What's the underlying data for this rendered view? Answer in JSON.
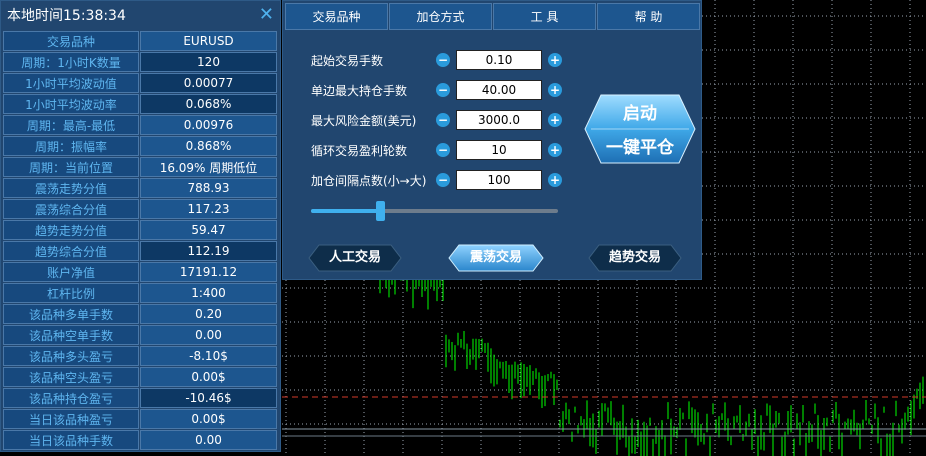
{
  "info": {
    "title": "本地时间15:38:34",
    "rows": [
      {
        "label": "交易品种",
        "value": "EURUSD"
      },
      {
        "label": "周期：1小时K数量",
        "value": "120"
      },
      {
        "label": "1小时平均波动值",
        "value": "0.00077"
      },
      {
        "label": "1小时平均波动率",
        "value": "0.068%"
      },
      {
        "label": "周期：最高-最低",
        "value": "0.00976"
      },
      {
        "label": "周期：振幅率",
        "value": "0.868%"
      },
      {
        "label": "周期：当前位置",
        "value": "16.09% 周期低位"
      },
      {
        "label": "震荡走势分值",
        "value": "788.93"
      },
      {
        "label": "震荡综合分值",
        "value": "117.23"
      },
      {
        "label": "趋势走势分值",
        "value": "59.47"
      },
      {
        "label": "趋势综合分值",
        "value": "112.19"
      },
      {
        "label": "账户净值",
        "value": "17191.12"
      },
      {
        "label": "杠杆比例",
        "value": "1:400"
      },
      {
        "label": "该品种多单手数",
        "value": "0.20"
      },
      {
        "label": "该品种空单手数",
        "value": "0.00"
      },
      {
        "label": "该品种多头盈亏",
        "value": "-8.10$"
      },
      {
        "label": "该品种空头盈亏",
        "value": "0.00$"
      },
      {
        "label": "该品种持仓盈亏",
        "value": "-10.46$"
      },
      {
        "label": "当日该品种盈亏",
        "value": "0.00$"
      },
      {
        "label": "当日该品种手数",
        "value": "0.00"
      }
    ],
    "close_icon": "close-icon"
  },
  "menu": [
    "交易品种",
    "加仓方式",
    "工 具",
    "帮 助"
  ],
  "params": [
    {
      "label": "起始交易手数",
      "value": "0.10"
    },
    {
      "label": "单边最大持仓手数",
      "value": "40.00"
    },
    {
      "label": "最大风险金额(美元)",
      "value": "3000.0"
    },
    {
      "label": "循环交易盈利轮数",
      "value": "10"
    },
    {
      "label": "加仓间隔点数(小→大)",
      "value": "100"
    }
  ],
  "slider_level": 0.28,
  "buttons": {
    "start": "启动",
    "close_all": "一键平仓",
    "manual": "人工交易",
    "oscillation": "震荡交易",
    "trend": "趋势交易"
  },
  "colors": {
    "panel_bg": "#21466f",
    "accent": "#3fb0ee",
    "candle": "#00ff00"
  }
}
